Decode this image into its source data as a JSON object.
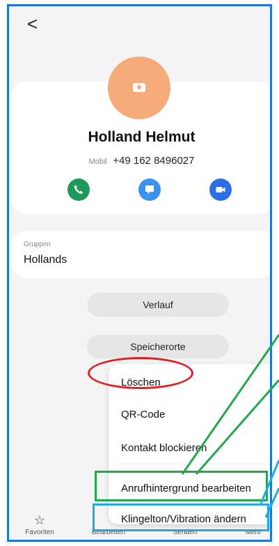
{
  "header": {
    "back_icon": "chevron-left-icon",
    "back_glyph": "<"
  },
  "contact": {
    "avatar_icon": "camera-icon",
    "name": "Holland  Helmut",
    "phone_type": "Mobil",
    "phone_number": "+49 162 8496027",
    "actions": [
      {
        "icon": "phone-icon",
        "color": "#1c9a5a"
      },
      {
        "icon": "message-icon",
        "color": "#3a93f0"
      },
      {
        "icon": "video-icon",
        "color": "#2a6ee8"
      }
    ]
  },
  "group": {
    "label": "Gruppen",
    "value": "Hollands"
  },
  "buttons": {
    "verlauf": "Verlauf",
    "speicherorte": "Speicherorte"
  },
  "menu": {
    "items": [
      "Löschen",
      "QR-Code",
      "Kontakt blockieren",
      "Anrufhintergrund bearbeiten",
      "Klingelton/Vibration ändern"
    ]
  },
  "bottom_nav": {
    "favoriten": "Favoriten",
    "bearbeiten": "Bearbeiten",
    "senden": "Senden",
    "mehr": "Mehr"
  },
  "annotation_colors": {
    "red": "#e02020",
    "green": "#22a84a",
    "blue": "#25a8e0",
    "frame": "#1a78d2"
  }
}
